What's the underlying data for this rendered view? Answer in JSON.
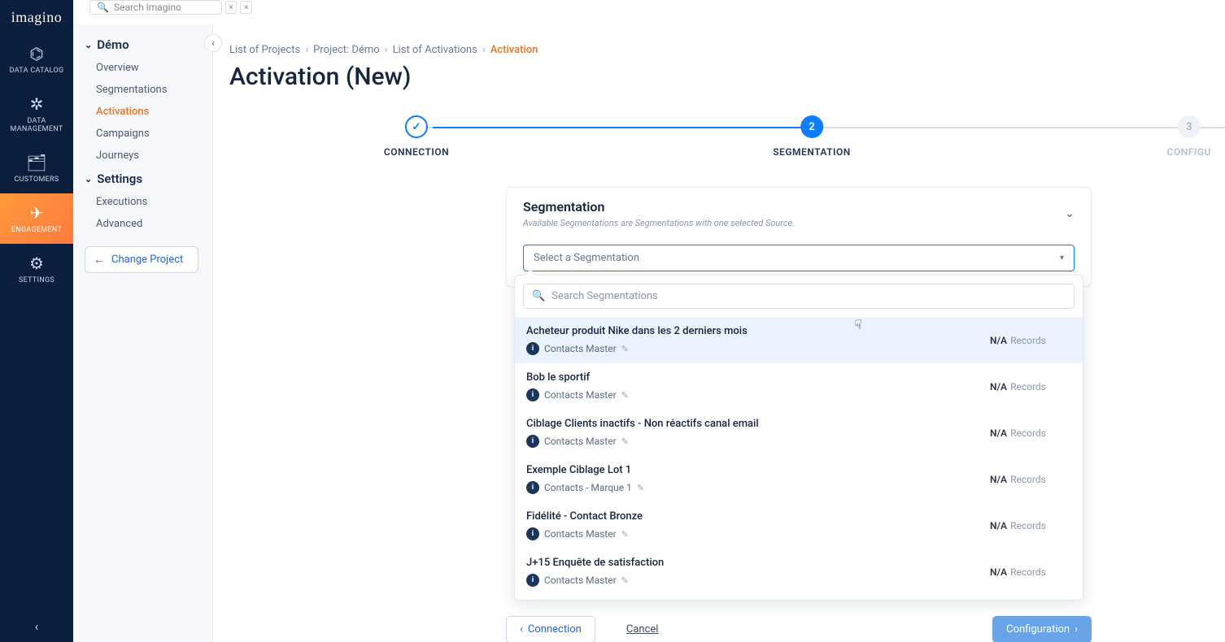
{
  "topSearch": {
    "placeholder": "Search imagino"
  },
  "brand": "imagino",
  "iconNav": [
    {
      "key": "data-catalog",
      "label": "DATA CATALOG",
      "glyph": "⌬"
    },
    {
      "key": "data-management",
      "label": "DATA MANAGEMENT",
      "glyph": "✲"
    },
    {
      "key": "customers",
      "label": "CUSTOMERS",
      "glyph": "🗂"
    },
    {
      "key": "engagement",
      "label": "ENGAGEMENT",
      "glyph": "✈",
      "active": true
    },
    {
      "key": "settings",
      "label": "SETTINGS",
      "glyph": "⚙"
    }
  ],
  "projectSidebar": {
    "groups": [
      {
        "title": "Démo",
        "items": [
          {
            "label": "Overview"
          },
          {
            "label": "Segmentations"
          },
          {
            "label": "Activations",
            "active": true
          },
          {
            "label": "Campaigns"
          },
          {
            "label": "Journeys"
          }
        ]
      },
      {
        "title": "Settings",
        "items": [
          {
            "label": "Executions"
          },
          {
            "label": "Advanced"
          }
        ]
      }
    ],
    "changeProject": "Change Project"
  },
  "breadcrumbs": [
    "List of Projects",
    "Project: Démo",
    "List of Activations",
    "Activation"
  ],
  "pageTitle": "Activation (New)",
  "stepper": [
    {
      "label": "CONNECTION",
      "state": "done",
      "mark": "✓"
    },
    {
      "label": "SEGMENTATION",
      "state": "current",
      "mark": "2"
    },
    {
      "label": "CONFIGU",
      "state": "future",
      "mark": "3"
    }
  ],
  "segmentationPanel": {
    "title": "Segmentation",
    "subtitle": "Available Segmentations are Segmentations with one selected Source.",
    "selectPlaceholder": "Select a Segmentation",
    "searchPlaceholder": "Search Segmentations",
    "recordsLabel": "Records",
    "items": [
      {
        "name": "Acheteur produit Nike dans les 2 derniers mois",
        "source": "Contacts Master",
        "records": "N/A",
        "highlight": true
      },
      {
        "name": "Bob le sportif",
        "source": "Contacts Master",
        "records": "N/A"
      },
      {
        "name": "Ciblage Clients inactifs - Non réactifs canal email",
        "source": "Contacts Master",
        "records": "N/A"
      },
      {
        "name": "Exemple Ciblage Lot 1",
        "source": "Contacts - Marque 1",
        "records": "N/A"
      },
      {
        "name": "Fidélité - Contact Bronze",
        "source": "Contacts Master",
        "records": "N/A"
      },
      {
        "name": "J+15 Enquête de satisfaction",
        "source": "Contacts Master",
        "records": "N/A"
      }
    ]
  },
  "actions": {
    "back": "Connection",
    "cancel": "Cancel",
    "next": "Configuration"
  }
}
